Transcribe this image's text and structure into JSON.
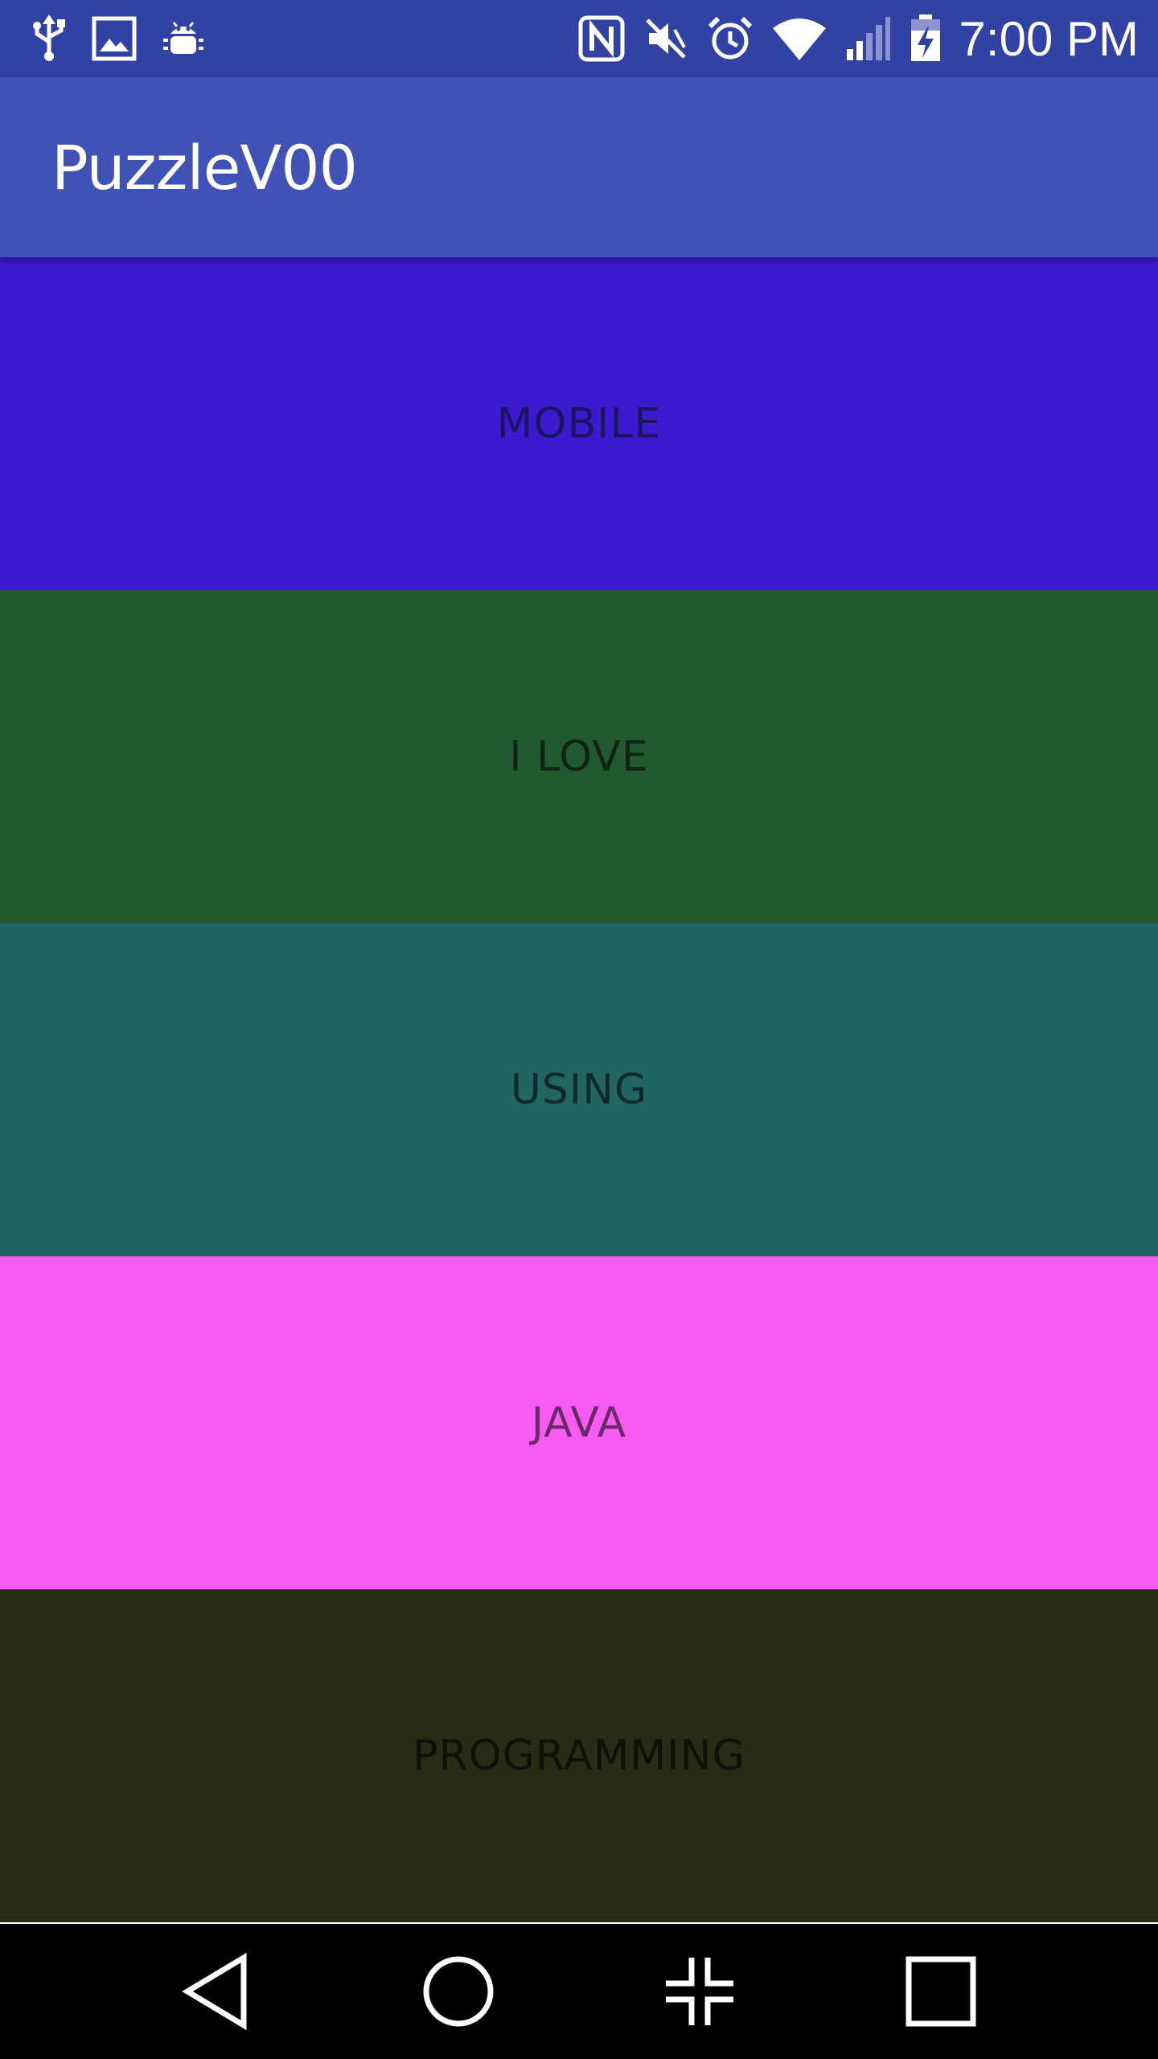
{
  "status_bar": {
    "time": "7:00 PM",
    "left_icons": [
      "usb-icon",
      "image-icon",
      "android-debug-icon"
    ],
    "right_icons": [
      "nfc-icon",
      "mute-icon",
      "alarm-icon",
      "wifi-icon",
      "signal-icon",
      "battery-charging-icon"
    ],
    "background": "#3241a4"
  },
  "app_bar": {
    "title": "PuzzleV00",
    "background": "#4052b6"
  },
  "blocks": [
    {
      "label": "MOBILE",
      "background": "#3b1ad0",
      "text_color": "#1c1460"
    },
    {
      "label": "I LOVE",
      "background": "#215a2f",
      "text_color": "#0f2414"
    },
    {
      "label": "USING",
      "background": "#216565",
      "text_color": "#0e2a2a"
    },
    {
      "label": "JAVA",
      "background": "#f75bf1",
      "text_color": "#6a2a68"
    },
    {
      "label": "PROGRAMMING",
      "background": "#292b17",
      "text_color": "#0f100a"
    }
  ],
  "nav_bar": {
    "buttons": [
      "back-icon",
      "home-icon",
      "dual-window-icon",
      "recents-icon"
    ]
  }
}
